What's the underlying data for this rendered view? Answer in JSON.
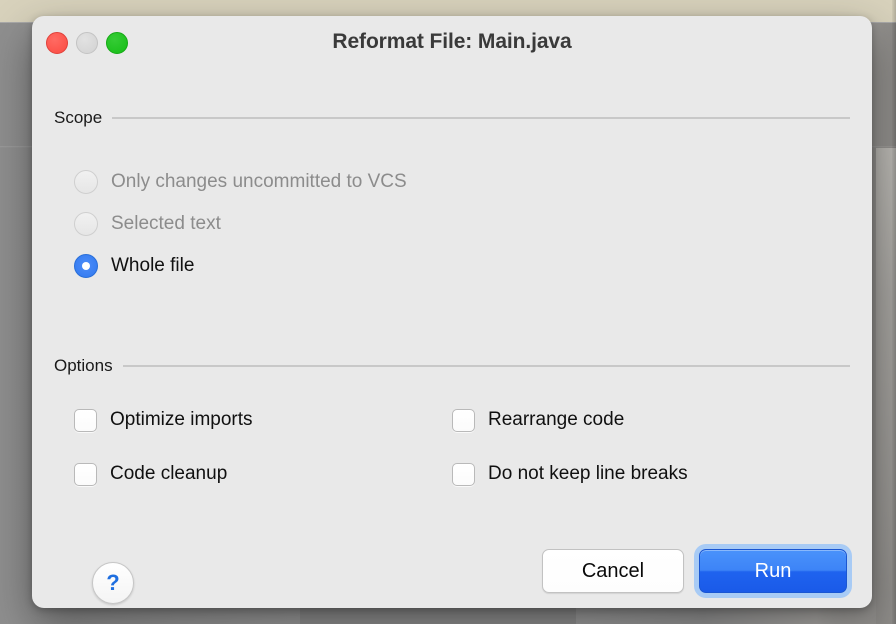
{
  "window": {
    "title": "Reformat File: Main.java",
    "traffic_lights": [
      {
        "name": "close",
        "color": "#fb4a41"
      },
      {
        "name": "minimize",
        "color": "#d2d2d2"
      },
      {
        "name": "zoom",
        "color": "#16bd16"
      }
    ]
  },
  "scope": {
    "header": "Scope",
    "options": [
      {
        "label": "Only changes uncommitted to VCS",
        "selected": false,
        "disabled": true
      },
      {
        "label": "Selected text",
        "selected": false,
        "disabled": true
      },
      {
        "label": "Whole file",
        "selected": true,
        "disabled": false
      }
    ]
  },
  "options_section": {
    "header": "Options",
    "checkboxes": [
      {
        "label": "Optimize imports",
        "checked": false
      },
      {
        "label": "Rearrange code",
        "checked": false
      },
      {
        "label": "Code cleanup",
        "checked": false
      },
      {
        "label": "Do not keep line breaks",
        "checked": false
      }
    ]
  },
  "footer": {
    "help_label": "?",
    "cancel_label": "Cancel",
    "run_label": "Run"
  },
  "colors": {
    "accent": "#2f78f0",
    "focus_ring": "#a8cbf5",
    "dialog_bg": "#e9e9e9",
    "disabled_text": "#8c8c8c"
  }
}
